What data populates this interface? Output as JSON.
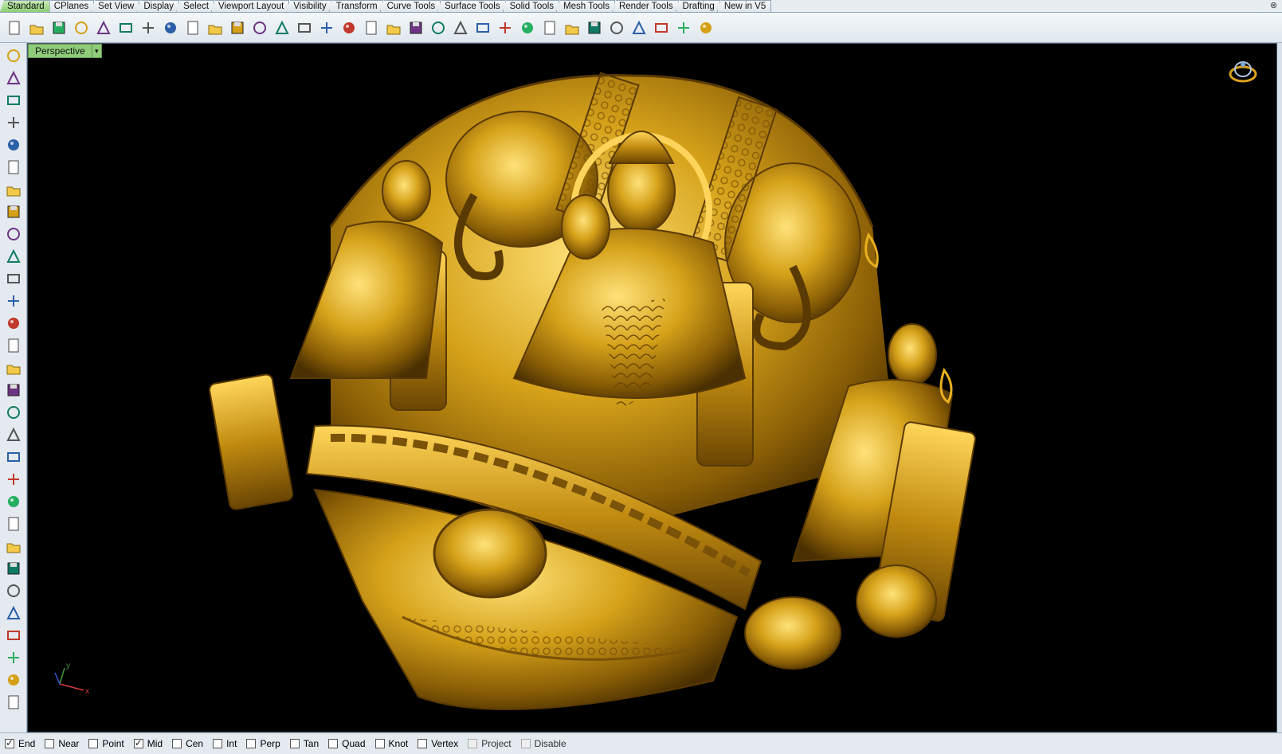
{
  "tabs": [
    {
      "label": "Standard",
      "active": true
    },
    {
      "label": "CPlanes",
      "active": false
    },
    {
      "label": "Set View",
      "active": false
    },
    {
      "label": "Display",
      "active": false
    },
    {
      "label": "Select",
      "active": false
    },
    {
      "label": "Viewport Layout",
      "active": false
    },
    {
      "label": "Visibility",
      "active": false
    },
    {
      "label": "Transform",
      "active": false
    },
    {
      "label": "Curve Tools",
      "active": false
    },
    {
      "label": "Surface Tools",
      "active": false
    },
    {
      "label": "Solid Tools",
      "active": false
    },
    {
      "label": "Mesh Tools",
      "active": false
    },
    {
      "label": "Render Tools",
      "active": false
    },
    {
      "label": "Drafting",
      "active": false
    },
    {
      "label": "New in V5",
      "active": false
    }
  ],
  "tab_close_glyph": "⊗",
  "toolbar_icons": [
    "new-file-icon",
    "open-folder-icon",
    "save-icon",
    "print-icon",
    "import-icon",
    "cut-icon",
    "copy-icon",
    "paste-icon",
    "undo-icon",
    "pan-hand-icon",
    "rotate-view-icon",
    "zoom-icon",
    "zoom-window-icon",
    "zoom-extents-icon",
    "zoom-selected-icon",
    "rotate-icon",
    "four-viewports-icon",
    "car-icon",
    "sheep-icon",
    "ray-icon",
    "cplane-icon",
    "light-bulb-icon",
    "lock-icon",
    "layers-icon",
    "color-wheel-icon",
    "shaded-sphere-icon",
    "rendered-sphere-icon",
    "blue-sphere-icon",
    "pin-icon",
    "options-gear-icon",
    "dimension-icon",
    "help-icon"
  ],
  "left_icons": [
    "select-arrow-icon",
    "point-icon",
    "polyline-icon",
    "curve-icon",
    "circle-icon",
    "ellipse-icon",
    "polygon-icon",
    "rectangle-icon",
    "hexagon-icon",
    "fillet-curve-icon",
    "surface-icon",
    "revolve-icon",
    "box-icon",
    "sphere-icon",
    "cylinder-icon",
    "plane-surface-icon",
    "gear-icon",
    "extrude-icon",
    "boolean-icon",
    "explode-icon",
    "group-icon",
    "array-icon",
    "blend-icon",
    "join-icon",
    "text-icon",
    "dimension-icon",
    "array-grid-icon",
    "transform-icon",
    "solid-box-icon",
    "more-icon"
  ],
  "viewport": {
    "name": "Perspective",
    "dropdown_glyph": "▾",
    "background": "#000000",
    "model_color": "#d4a017",
    "axis_labels": {
      "x": "x",
      "y": "y"
    }
  },
  "osnaps": [
    {
      "label": "End",
      "checked": true,
      "disabled": false
    },
    {
      "label": "Near",
      "checked": false,
      "disabled": false
    },
    {
      "label": "Point",
      "checked": false,
      "disabled": false
    },
    {
      "label": "Mid",
      "checked": true,
      "disabled": false
    },
    {
      "label": "Cen",
      "checked": false,
      "disabled": false
    },
    {
      "label": "Int",
      "checked": false,
      "disabled": false
    },
    {
      "label": "Perp",
      "checked": false,
      "disabled": false
    },
    {
      "label": "Tan",
      "checked": false,
      "disabled": false
    },
    {
      "label": "Quad",
      "checked": false,
      "disabled": false
    },
    {
      "label": "Knot",
      "checked": false,
      "disabled": false
    },
    {
      "label": "Vertex",
      "checked": false,
      "disabled": false
    },
    {
      "label": "Project",
      "checked": false,
      "disabled": true
    },
    {
      "label": "Disable",
      "checked": false,
      "disabled": true
    }
  ]
}
